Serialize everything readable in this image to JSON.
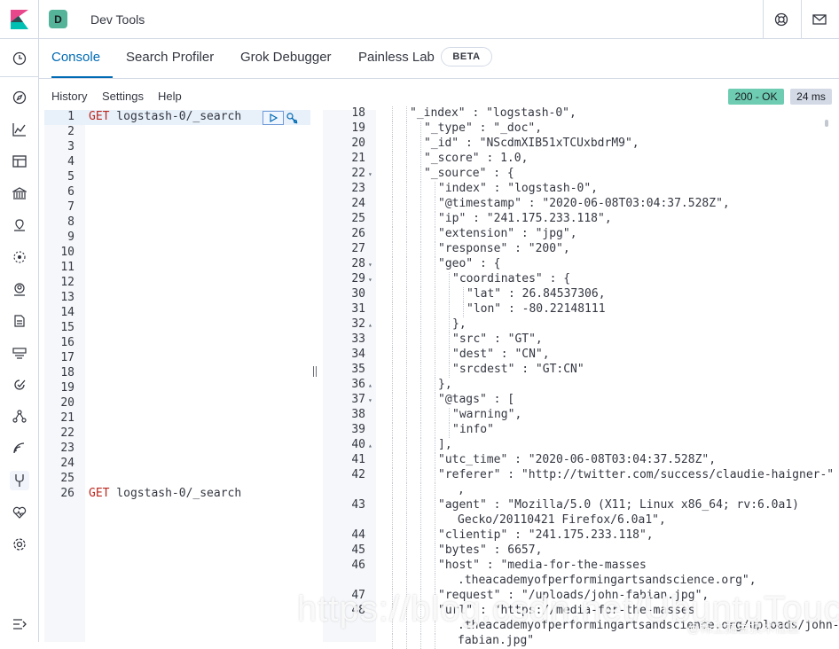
{
  "header": {
    "space_initial": "D",
    "app_title": "Dev Tools"
  },
  "icons": {
    "logo": "kibana-logo-icon",
    "help": "help-lifebuoy-icon",
    "mail": "mail-icon",
    "collapse": "collapse-menu-icon"
  },
  "sidenav": [
    "clock-icon",
    "compass-icon",
    "chart-icon",
    "dashboard-icon",
    "canvas-icon",
    "maps-icon",
    "ml-icon",
    "users-icon",
    "logs-icon",
    "uptime-icon",
    "apm-icon",
    "graph-icon",
    "wifi-icon",
    "devtools-icon",
    "heart-icon",
    "gear-icon"
  ],
  "tabs": [
    {
      "label": "Console"
    },
    {
      "label": "Search Profiler"
    },
    {
      "label": "Grok Debugger"
    },
    {
      "label": "Painless Lab"
    }
  ],
  "beta_badge": "BETA",
  "menu": {
    "history": "History",
    "settings": "Settings",
    "help": "Help"
  },
  "status": {
    "code": "200 - OK",
    "time": "24 ms"
  },
  "request": {
    "line_numbers": [
      "1",
      "2",
      "3",
      "4",
      "5",
      "6",
      "7",
      "8",
      "9",
      "10",
      "11",
      "12",
      "13",
      "14",
      "15",
      "16",
      "17",
      "18",
      "19",
      "20",
      "21",
      "22",
      "23",
      "24",
      "25",
      "26"
    ],
    "line1_method": "GET",
    "line1_path": " logstash-0/_search",
    "line26_method": "GET",
    "line26_path": " logstash-0/_search"
  },
  "response": {
    "lines": [
      {
        "n": "18",
        "code": "\"_index\" : \"logstash-0\",",
        "depth": 2
      },
      {
        "n": "19",
        "code": "\"_type\" : \"_doc\",",
        "depth": 3
      },
      {
        "n": "20",
        "code": "\"_id\" : \"NScdmXIB51xTCUxbdrM9\",",
        "depth": 3
      },
      {
        "n": "21",
        "code": "\"_score\" : 1.0,",
        "depth": 3
      },
      {
        "n": "22",
        "code": "\"_source\" : {",
        "depth": 3,
        "fold": "▾"
      },
      {
        "n": "23",
        "code": "\"index\" : \"logstash-0\",",
        "depth": 4
      },
      {
        "n": "24",
        "code": "\"@timestamp\" : \"2020-06-08T03:04:37.528Z\",",
        "depth": 4
      },
      {
        "n": "25",
        "code": "\"ip\" : \"241.175.233.118\",",
        "depth": 4
      },
      {
        "n": "26",
        "code": "\"extension\" : \"jpg\",",
        "depth": 4
      },
      {
        "n": "27",
        "code": "\"response\" : \"200\",",
        "depth": 4
      },
      {
        "n": "28",
        "code": "\"geo\" : {",
        "depth": 4,
        "fold": "▾"
      },
      {
        "n": "29",
        "code": "\"coordinates\" : {",
        "depth": 5,
        "fold": "▾"
      },
      {
        "n": "30",
        "code": "\"lat\" : 26.84537306,",
        "depth": 6
      },
      {
        "n": "31",
        "code": "\"lon\" : -80.22148111",
        "depth": 6
      },
      {
        "n": "32",
        "code": "},",
        "depth": 5,
        "fold": "▴"
      },
      {
        "n": "33",
        "code": "\"src\" : \"GT\",",
        "depth": 5
      },
      {
        "n": "34",
        "code": "\"dest\" : \"CN\",",
        "depth": 5
      },
      {
        "n": "35",
        "code": "\"srcdest\" : \"GT:CN\"",
        "depth": 5
      },
      {
        "n": "36",
        "code": "},",
        "depth": 4,
        "fold": "▴"
      },
      {
        "n": "37",
        "code": "\"@tags\" : [",
        "depth": 4,
        "fold": "▾"
      },
      {
        "n": "38",
        "code": "\"warning\",",
        "depth": 5
      },
      {
        "n": "39",
        "code": "\"info\"",
        "depth": 5
      },
      {
        "n": "40",
        "code": "],",
        "depth": 4,
        "fold": "▴"
      },
      {
        "n": "41",
        "code": "\"utc_time\" : \"2020-06-08T03:04:37.528Z\",",
        "depth": 4
      },
      {
        "n": "42",
        "code": "\"referer\" : \"http://twitter.com/success/claudie-haigner-\"",
        "depth": 4
      },
      {
        "n": "",
        "code": ",",
        "depth": 4,
        "cont": true
      },
      {
        "n": "43",
        "code": "\"agent\" : \"Mozilla/5.0 (X11; Linux x86_64; rv:6.0a1)",
        "depth": 4
      },
      {
        "n": "",
        "code": "Gecko/20110421 Firefox/6.0a1\",",
        "depth": 4,
        "cont": true
      },
      {
        "n": "44",
        "code": "\"clientip\" : \"241.175.233.118\",",
        "depth": 4
      },
      {
        "n": "45",
        "code": "\"bytes\" : 6657,",
        "depth": 4
      },
      {
        "n": "46",
        "code": "\"host\" : \"media-for-the-masses",
        "depth": 4
      },
      {
        "n": "",
        "code": ".theacademyofperformingartsandscience.org\",",
        "depth": 4,
        "cont": true
      },
      {
        "n": "47",
        "code": "\"request\" : \"/uploads/john-fabian.jpg\",",
        "depth": 4
      },
      {
        "n": "48",
        "code": "\"url\" : \"https://media-for-the-masses",
        "depth": 4
      },
      {
        "n": "",
        "code": ".theacademyofperformingartsandscience.org/uploads/john-",
        "depth": 4,
        "cont": true
      },
      {
        "n": "",
        "code": "fabian.jpg\"",
        "depth": 4,
        "cont": true
      }
    ]
  },
  "watermark": {
    "main": "https://blog.csdn.net/UbuntuTouch",
    "sub": "@稀土掘金技术社区"
  }
}
